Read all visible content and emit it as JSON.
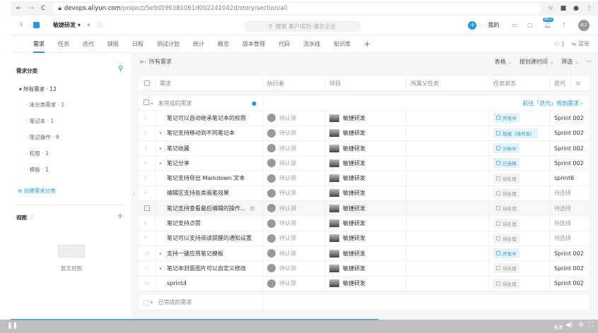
{
  "browser": {
    "url_host": "devops.aliyun.com",
    "url_path": "/project/5e9d590381061d002241042d/story/section/all"
  },
  "app": {
    "project": "敏捷研发",
    "search_placeholder": "搜索 客户成功-演示企业",
    "mine": "我的",
    "notif_badge": "99+",
    "avatar": "张三"
  },
  "nav": {
    "tabs": [
      "需求",
      "任务",
      "迭代",
      "缺陷",
      "日程",
      "测试计划",
      "统计",
      "概览",
      "版本管理",
      "代码",
      "流水线",
      "知识库"
    ],
    "members": "1",
    "menu": "菜单"
  },
  "sidebar": {
    "title": "需求分类",
    "root": "所有需求 · 12",
    "items": [
      "未分类需求 · 1",
      "笔记本 · 1",
      "笔记操作 · 8",
      "权限 · 1",
      "模版 · 1"
    ],
    "create": "创建需求分类",
    "views_title": "视图",
    "empty_views": "暂无视图"
  },
  "toolbar": {
    "title": "所有需求",
    "view": "表格",
    "sort": "按创建时间",
    "filter": "筛选"
  },
  "table": {
    "headers": [
      "需求",
      "执行者",
      "项目",
      "所属父任务",
      "任务状态",
      "迭代"
    ],
    "group_open": "未完成的需求",
    "plan_link": "前往「迭代」规划需求",
    "group_done": "已完成的需求",
    "rows": [
      {
        "no": "1",
        "expand": false,
        "title": "笔记可以自动继承笔记本的权限",
        "assignee": "待认领",
        "project": "敏捷研发",
        "status": "开发中",
        "status_color": "blue",
        "sprint": "Sprint 002"
      },
      {
        "no": "2",
        "expand": true,
        "title": "笔记支持移动到不同笔记本",
        "assignee": "待认领",
        "project": "敏捷研发",
        "status": "就绪（待开发）",
        "status_color": "blue",
        "sprint": "Sprint 002"
      },
      {
        "no": "3",
        "expand": true,
        "title": "笔记收藏",
        "assignee": "待认领",
        "project": "敏捷研发",
        "status": "分析中",
        "status_color": "blue",
        "sprint": "Sprint 002"
      },
      {
        "no": "4",
        "expand": true,
        "title": "笔记分享",
        "assignee": "待认领",
        "project": "敏捷研发",
        "status": "已选择",
        "status_color": "blue",
        "sprint": "Sprint 002"
      },
      {
        "no": "5",
        "expand": false,
        "title": "笔记支持导出 Markdown 文本",
        "assignee": "待认领",
        "project": "敏捷研发",
        "status": "待处理",
        "status_color": "gray",
        "sprint": "sprint6"
      },
      {
        "no": "6",
        "expand": false,
        "title": "编辑区支持各类画笔效果",
        "assignee": "待认领",
        "project": "敏捷研发",
        "status": "待处理",
        "status_color": "gray",
        "sprint": "待选择"
      },
      {
        "no": "",
        "expand": false,
        "title": "笔记支持查看最后编辑的操作...",
        "assignee": "待认领",
        "project": "敏捷研发",
        "status": "待处理",
        "status_color": "gray",
        "sprint": "待选择"
      },
      {
        "no": "8",
        "expand": false,
        "title": "笔记支持点赞",
        "assignee": "待认领",
        "project": "敏捷研发",
        "status": "待处理",
        "status_color": "gray",
        "sprint": "待选择"
      },
      {
        "no": "9",
        "expand": false,
        "title": "笔记可以支持阅读提醒的通知设置",
        "assignee": "待认领",
        "project": "敏捷研发",
        "status": "待处理",
        "status_color": "gray",
        "sprint": "待选择"
      },
      {
        "no": "10",
        "expand": true,
        "title": "支持一键应用笔记模板",
        "assignee": "待认领",
        "project": "敏捷研发",
        "status": "开发中",
        "status_color": "blue",
        "sprint": "Sprint 002"
      },
      {
        "no": "11",
        "expand": true,
        "title": "笔记本封面图片可以自定义修改",
        "assignee": "待认领",
        "project": "敏捷研发",
        "status": "待处理",
        "status_color": "gray",
        "sprint": "Sprint 002"
      },
      {
        "no": "12",
        "expand": false,
        "title": "sprint4",
        "assignee": "待认领",
        "project": "敏捷研发",
        "status": "待处理",
        "status_color": "gray",
        "sprint": "Sprint 002"
      }
    ]
  },
  "video": {
    "quality": "高清"
  }
}
